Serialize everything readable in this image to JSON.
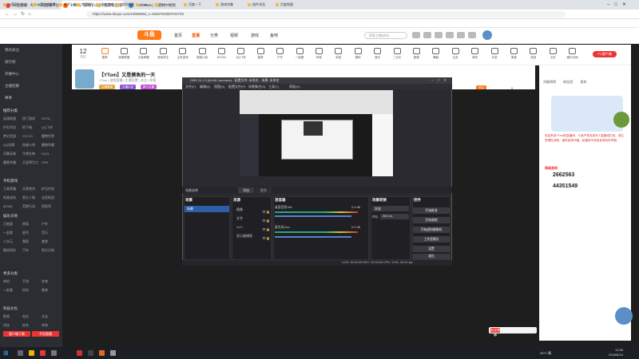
{
  "browser": {
    "tabs": [
      "斗鱼直播 - 每个人的直播平台",
      "YTom] - 游戏 | 斗鱼 | 加游戏直播",
      "BBCMuss | 导航栏 | 视频"
    ],
    "url": "https://www.douyu.com/10095952_t=1528760383702725",
    "bookmarks": [
      "火狐官方站点",
      "火狐游戏推荐",
      "新手上路",
      "常用网址",
      "网络游戏",
      "我的博客",
      "7.win...",
      "百度地图",
      "Search",
      "百度一下",
      "游戏合集",
      "插件浏览"
    ]
  },
  "site": {
    "logo": "斗鱼",
    "nav": [
      "首页",
      "直播",
      "分类",
      "视频",
      "游戏",
      "鱼吧"
    ],
    "active_nav": "直播",
    "search_placeholder": "搜索主播/房间",
    "login_label": "登录"
  },
  "categories": [
    "12",
    "关注",
    "推荐",
    "英雄联盟",
    "王者荣耀",
    "绝地求生",
    "主机游戏",
    "穿越火线",
    "DOTA2",
    "QQ飞车",
    "星秀",
    "户外",
    "一起看",
    "体育",
    "科技",
    "数码",
    "音乐",
    "二次元",
    "颜值",
    "舞蹈",
    "交友",
    "单机",
    "手游",
    "美食",
    "旅游",
    "文化",
    "娱乐天地",
    "PC客户端"
  ],
  "sidebar": {
    "top_items": [
      "我的关注",
      "排行榜",
      "开播中心",
      "主播招募",
      "赛事"
    ],
    "section_hot": "推荐分类",
    "grid1": [
      [
        "英雄联盟",
        "热门游戏",
        "DOTA"
      ],
      [
        "炉石传说",
        "地下城",
        "QQ飞车"
      ],
      [
        "梦幻西游",
        "CS:GO",
        "魔兽世界"
      ],
      [
        "QQ炫舞",
        "穿越火线",
        "魔兽争霸"
      ],
      [
        "风暴英雄",
        "守望先锋",
        "H1Z1"
      ],
      [
        "魔兽争霸",
        "天涯明月刀",
        "FIFA"
      ]
    ],
    "section_mobile": "手机游戏",
    "grid2": [
      [
        "王者荣耀",
        "光荣使命",
        "炉石传说"
      ],
      [
        "刺激战场",
        "第五人格",
        "全民枪战"
      ],
      [
        "MOBA",
        "荒野行动",
        "阴阳师"
      ]
    ],
    "section_ent": "娱乐天地",
    "grid3": [
      [
        "正能量",
        "颜值",
        "户外"
      ],
      [
        "一起看",
        "星秀",
        "音乐"
      ],
      [
        "二次元",
        "舞蹈",
        "美食"
      ],
      [
        "数码科技",
        "汽车",
        "鱼乐天地"
      ]
    ],
    "section_more": "更多分类",
    "grid4": [
      [
        "单机",
        "手游",
        "女神"
      ],
      [
        "一起看",
        "科技",
        "教育"
      ]
    ],
    "section_end": "科技文化",
    "grid5": [
      [
        "影视",
        "电台",
        "文化"
      ],
      [
        "科技",
        "综合",
        "体育"
      ]
    ],
    "btn_download": "客户端下载",
    "btn_app": "手机直播"
  },
  "room": {
    "title": "【YTom】又是摸鱼的一天",
    "meta": "YTom | 游戏直播 | 主播设置 | 关注 | 举报",
    "tags": [
      "主播等级",
      "主播认证",
      "新人主播"
    ],
    "follow_label": "关注",
    "fans": "0"
  },
  "obs": {
    "title": "OBS 20.1.3 (64-bit, windows) - 配置文件: 未命名 - 场景: 未命名",
    "menu": [
      "文件(F)",
      "编辑(E)",
      "视图(V)",
      "配置文件(P)",
      "场景集合(S)",
      "工具(T)",
      "帮助(H)"
    ],
    "dock_title": "场景选择",
    "tabs": [
      "添加",
      "更多"
    ],
    "docks": {
      "scenes": "场景",
      "sources": "来源",
      "mixer": "混音器",
      "transitions": "场景转换",
      "controls": "控件"
    },
    "scene_item": "场景",
    "sources": [
      "图像",
      "文字",
      "VLC",
      "显示器捕获"
    ],
    "mixer_tracks": [
      "桌面音频 Mic",
      "麦克风/Aux"
    ],
    "mixer_db": [
      "0.0 dB",
      "0.0 dB"
    ],
    "transition": "渐变",
    "duration_label": "时长",
    "duration": "300 ms",
    "controls": [
      "开始推流",
      "开始录制",
      "开始虚拟摄像机",
      "工作室模式",
      "设置",
      "退出"
    ],
    "status": "LIVE: 00:00:00   REC: 00:00:00   CPU: 3.3%, 30.00 fps"
  },
  "chat": {
    "tabs": [
      "贡献周榜",
      "粉丝团",
      "贵宾"
    ],
    "notice": "欢迎来到YTom的直播间，斗鱼严禁未成年人直播或打赏。请注意理性消费，谨防各类诈骗，若遇到不良信息请及时举报。",
    "sponsor": "网络游戏",
    "nums": [
      "2662563",
      "44351549"
    ],
    "gift_label": "发送弹幕"
  },
  "taskbar": {
    "weather": "26°C 晴",
    "time": "11:56",
    "date": "2018/6/14"
  }
}
